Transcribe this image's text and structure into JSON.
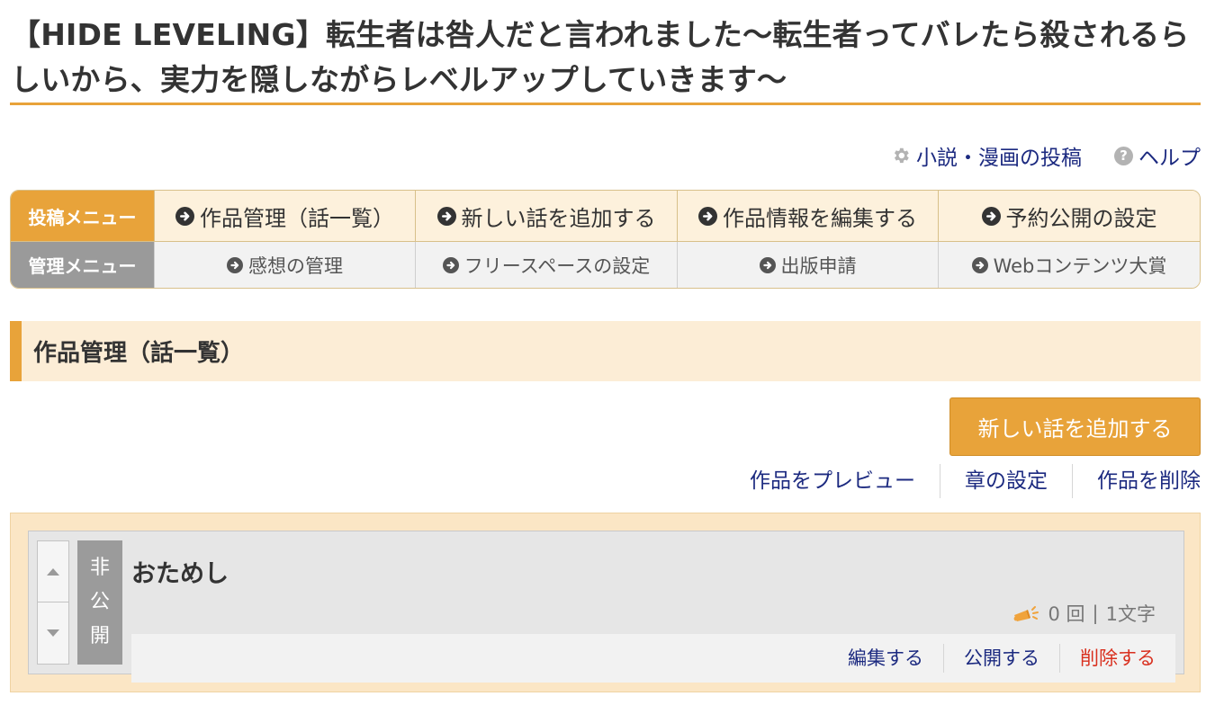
{
  "page": {
    "title": "【HIDE LEVELING】転生者は咎人だと言われました〜転生者ってバレたら殺されるらしいから、実力を隠しながらレベルアップしていきます〜"
  },
  "top_links": [
    {
      "label": "小説・漫画の投稿",
      "icon": "gear-icon"
    },
    {
      "label": "ヘルプ",
      "icon": "question-icon",
      "icon_glyph": "?"
    }
  ],
  "menu": {
    "post_menu_label": "投稿メニュー",
    "post_items": [
      "作品管理（話一覧）",
      "新しい話を追加する",
      "作品情報を編集する",
      "予約公開の設定"
    ],
    "manage_menu_label": "管理メニュー",
    "manage_items": [
      "感想の管理",
      "フリースペースの設定",
      "出版申請",
      "Webコンテンツ大賞"
    ]
  },
  "section": {
    "title": "作品管理（話一覧）"
  },
  "actions": {
    "add_episode": "新しい話を追加する",
    "preview": "作品をプレビュー",
    "chapter_settings": "章の設定",
    "delete_work": "作品を削除"
  },
  "episodes": [
    {
      "status_chars": [
        "非",
        "公",
        "開"
      ],
      "title": "おためし",
      "count": "0 回",
      "separator": "|",
      "chars": "1文字",
      "edit": "編集する",
      "publish": "公開する",
      "delete": "削除する"
    }
  ],
  "colors": {
    "accent": "#e8a33a",
    "link": "#1c2a80",
    "danger": "#d9301f",
    "status_gray": "#9b9b9b"
  }
}
